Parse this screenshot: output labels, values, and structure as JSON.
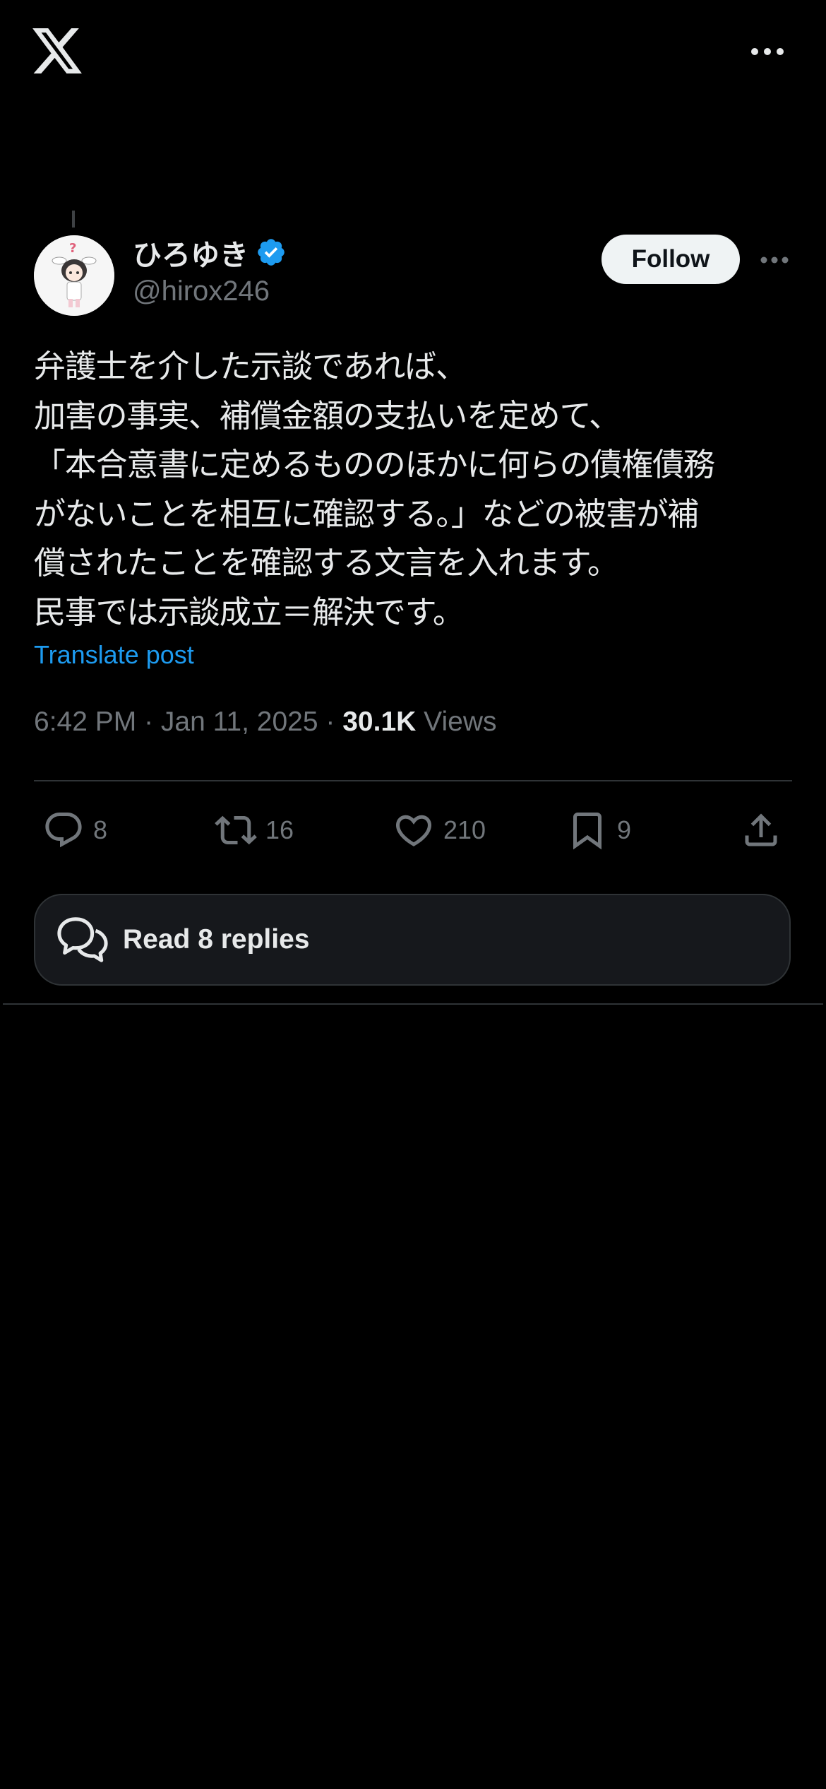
{
  "header": {
    "logo_icon": "x-logo-icon",
    "more_icon": "more-horizontal-icon"
  },
  "author": {
    "display_name": "ひろゆき",
    "handle": "@hirox246",
    "verified": true,
    "avatar_icon": "avatar-anime-girl"
  },
  "follow_label": "Follow",
  "post": {
    "lines": [
      "弁護士を介した示談であれば、",
      "加害の事実、補償金額の支払いを定めて、",
      "「本合意書に定めるもののほかに何らの債権債務",
      "がないことを相互に確認する。」などの被害が補",
      "償されたことを確認する文言を入れます。",
      "民事では示談成立＝解決です。"
    ],
    "translate_label": "Translate post",
    "time": "6:42 PM",
    "date": "Jan 11, 2025",
    "views_count": "30.1K",
    "views_label": "Views"
  },
  "actions": {
    "replies": "8",
    "reposts": "16",
    "likes": "210",
    "bookmarks": "9"
  },
  "read_replies_label": "Read 8 replies",
  "colors": {
    "background": "#000000",
    "text": "#e7e9ea",
    "muted": "#71767b",
    "link": "#1d9bf0",
    "verified": "#1d9bf0",
    "divider": "#2f3336"
  }
}
